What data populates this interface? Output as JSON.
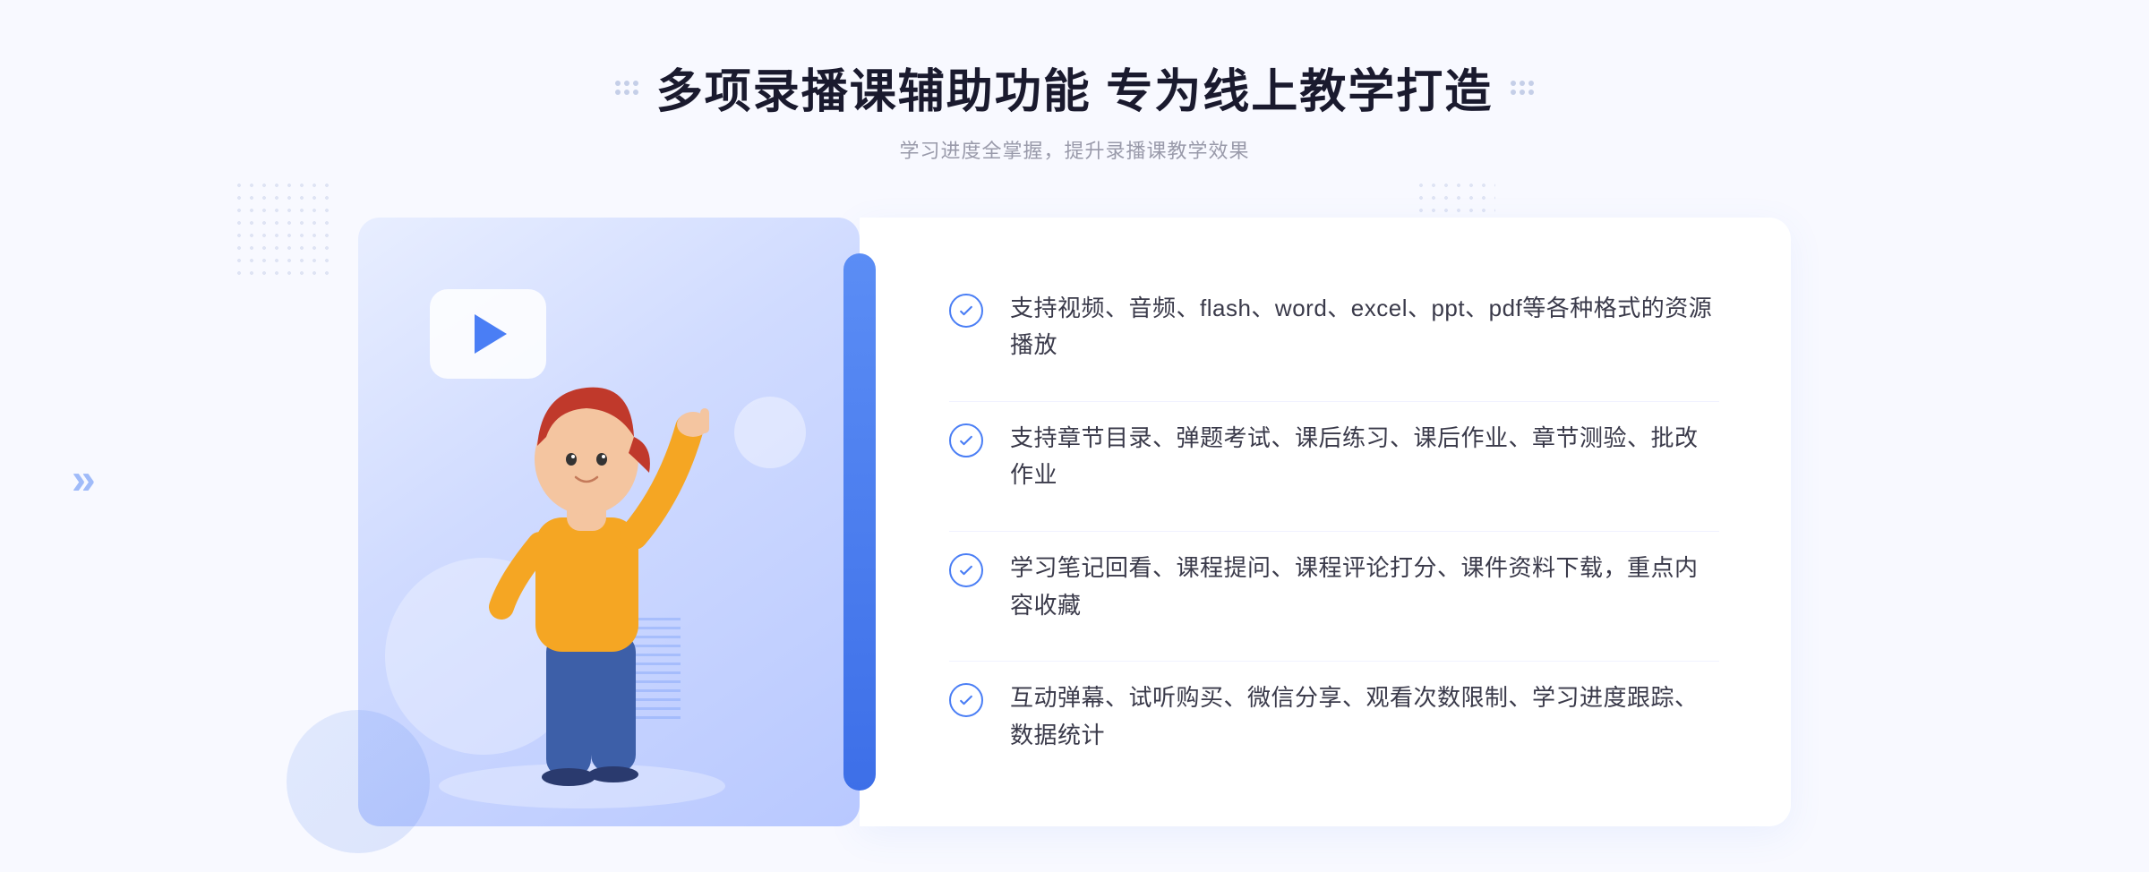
{
  "page": {
    "background_color": "#f5f7ff"
  },
  "header": {
    "title": "多项录播课辅助功能 专为线上教学打造",
    "subtitle": "学习进度全掌握，提升录播课教学效果",
    "left_deco_icon": "grid-dots-icon",
    "right_deco_icon": "grid-dots-icon"
  },
  "features": [
    {
      "id": 1,
      "text": "支持视频、音频、flash、word、excel、ppt、pdf等各种格式的资源播放",
      "icon": "check-circle-icon"
    },
    {
      "id": 2,
      "text": "支持章节目录、弹题考试、课后练习、课后作业、章节测验、批改作业",
      "icon": "check-circle-icon"
    },
    {
      "id": 3,
      "text": "学习笔记回看、课程提问、课程评论打分、课件资料下载，重点内容收藏",
      "icon": "check-circle-icon"
    },
    {
      "id": 4,
      "text": "互动弹幕、试听购买、微信分享、观看次数限制、学习进度跟踪、数据统计",
      "icon": "check-circle-icon"
    }
  ],
  "illustration": {
    "play_button_alt": "play-button",
    "character_alt": "teaching-character"
  },
  "navigation": {
    "left_arrow": "«",
    "right_arrow": "»"
  }
}
